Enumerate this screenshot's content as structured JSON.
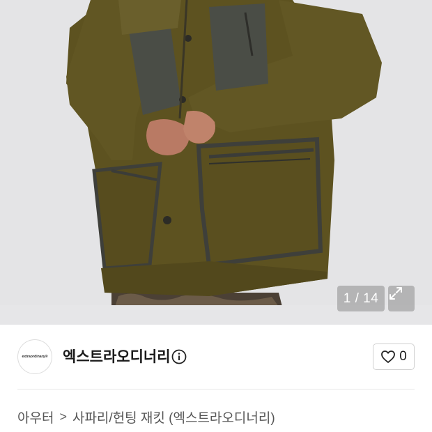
{
  "gallery": {
    "current_index": "1",
    "total": "14",
    "counter_text": "1 / 14",
    "image_alt": "product-photo-jacket",
    "colors": {
      "jacket": "#5d5220",
      "panel": "#4a4d46",
      "background": "#e4e4e6"
    }
  },
  "store": {
    "logo_text": "extraordinary®",
    "name": "엑스트라오디너리",
    "like_count": "0"
  },
  "breadcrumb": {
    "category": "아우터",
    "separator": ">",
    "subcategory": "사파리/헌팅 재킷 (엑스트라오디너리)"
  }
}
